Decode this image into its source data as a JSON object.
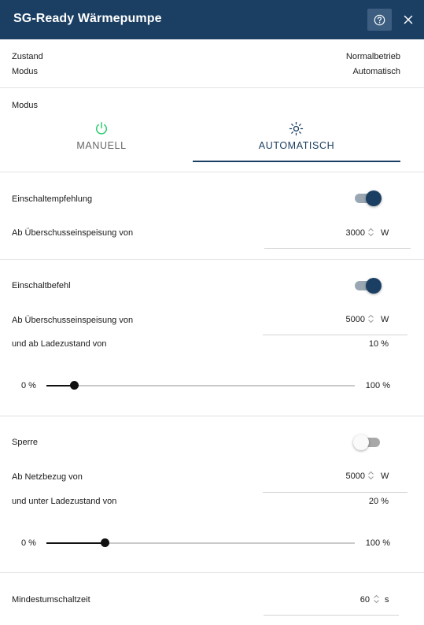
{
  "header": {
    "title": "SG-Ready Wärmepumpe",
    "help_icon": "help-circle-icon",
    "close_icon": "close-icon",
    "color": "#1b3f63"
  },
  "status": {
    "zustand_label": "Zustand",
    "zustand_value": "Normalbetrieb",
    "modus_label": "Modus",
    "modus_value": "Automatisch"
  },
  "mode_section": {
    "label": "Modus",
    "tabs": [
      {
        "label": "MANUELL",
        "icon": "power-icon",
        "icon_color": "#2ecc71",
        "selected": false
      },
      {
        "label": "AUTOMATISCH",
        "icon": "sun-icon",
        "icon_color": "#1b3f63",
        "selected": true
      }
    ]
  },
  "einschaltempfehlung": {
    "label": "Einschaltempfehlung",
    "enabled": true,
    "surplus_label": "Ab Überschusseinspeisung von",
    "surplus_value": "3000",
    "surplus_unit": "W"
  },
  "einschaltbefehl": {
    "label": "Einschaltbefehl",
    "enabled": true,
    "surplus_label": "Ab Überschusseinspeisung von",
    "surplus_value": "5000",
    "surplus_unit": "W",
    "soc_label": "und ab Ladezustand von",
    "soc_value": "10 %",
    "slider_min": "0 %",
    "slider_max": "100 %",
    "slider_level": 0.09
  },
  "sperre": {
    "label": "Sperre",
    "enabled": false,
    "grid_label": "Ab Netzbezug von",
    "grid_value": "5000",
    "grid_unit": "W",
    "soc_label": "und unter Ladezustand von",
    "soc_value": "20 %",
    "slider_min": "0 %",
    "slider_max": "100 %",
    "slider_level": 0.19
  },
  "mindestumschaltzeit": {
    "label": "Mindestumschaltzeit",
    "value": "60",
    "unit": "s"
  }
}
